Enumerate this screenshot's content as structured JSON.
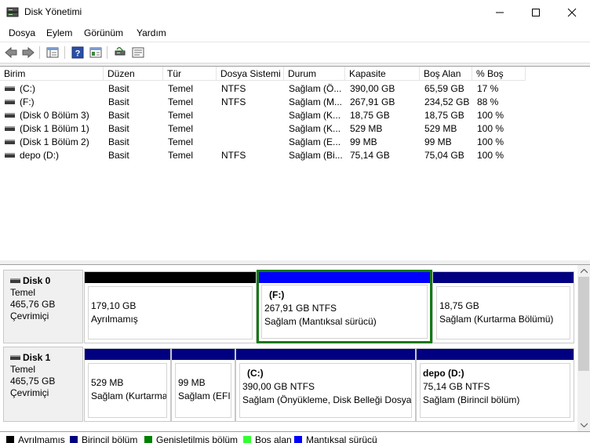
{
  "window": {
    "title": "Disk Yönetimi"
  },
  "menu": [
    "Dosya",
    "Eylem",
    "Görünüm",
    "Yardım"
  ],
  "columns": [
    "Birim",
    "Düzen",
    "Tür",
    "Dosya Sistemi",
    "Durum",
    "Kapasite",
    "Boş Alan",
    "% Boş"
  ],
  "volumes": [
    {
      "name": "(C:)",
      "layout": "Basit",
      "type": "Temel",
      "fs": "NTFS",
      "status": "Sağlam (Ö...",
      "capacity": "390,00 GB",
      "free": "65,59 GB",
      "pct": "17 %"
    },
    {
      "name": "(F:)",
      "layout": "Basit",
      "type": "Temel",
      "fs": "NTFS",
      "status": "Sağlam (M...",
      "capacity": "267,91 GB",
      "free": "234,52 GB",
      "pct": "88 %"
    },
    {
      "name": "(Disk 0 Bölüm 3)",
      "layout": "Basit",
      "type": "Temel",
      "fs": "",
      "status": "Sağlam (K...",
      "capacity": "18,75 GB",
      "free": "18,75 GB",
      "pct": "100 %"
    },
    {
      "name": "(Disk 1 Bölüm 1)",
      "layout": "Basit",
      "type": "Temel",
      "fs": "",
      "status": "Sağlam (K...",
      "capacity": "529 MB",
      "free": "529 MB",
      "pct": "100 %"
    },
    {
      "name": "(Disk 1 Bölüm 2)",
      "layout": "Basit",
      "type": "Temel",
      "fs": "",
      "status": "Sağlam (E...",
      "capacity": "99 MB",
      "free": "99 MB",
      "pct": "100 %"
    },
    {
      "name": "depo (D:)",
      "layout": "Basit",
      "type": "Temel",
      "fs": "NTFS",
      "status": "Sağlam (Bi...",
      "capacity": "75,14 GB",
      "free": "75,04 GB",
      "pct": "100 %"
    }
  ],
  "disks": [
    {
      "name": "Disk 0",
      "type": "Temel",
      "size": "465,76 GB",
      "state": "Çevrimiçi",
      "partitions": [
        {
          "title": "",
          "size": "179,10 GB",
          "status": "Ayrılmamış",
          "kind": "unallocated"
        },
        {
          "title": "(F:)",
          "size": "267,91 GB NTFS",
          "status": "Sağlam (Mantıksal sürücü)",
          "kind": "logical"
        },
        {
          "title": "",
          "size": "18,75 GB",
          "status": "Sağlam (Kurtarma Bölümü)",
          "kind": "primary"
        }
      ]
    },
    {
      "name": "Disk 1",
      "type": "Temel",
      "size": "465,75 GB",
      "state": "Çevrimiçi",
      "partitions": [
        {
          "title": "",
          "size": "529 MB",
          "status": "Sağlam (Kurtarma",
          "kind": "primary"
        },
        {
          "title": "",
          "size": "99 MB",
          "status": "Sağlam (EFI S",
          "kind": "primary"
        },
        {
          "title": "(C:)",
          "size": "390,00 GB NTFS",
          "status": "Sağlam (Önyükleme, Disk Belleği Dosyas",
          "kind": "primary"
        },
        {
          "title": "depo  (D:)",
          "size": "75,14 GB NTFS",
          "status": "Sağlam (Birincil bölüm)",
          "kind": "primary"
        }
      ]
    }
  ],
  "legend": [
    {
      "label": "Ayrılmamış",
      "color": "#000000"
    },
    {
      "label": "Birincil bölüm",
      "color": "#000080"
    },
    {
      "label": "Genişletilmiş bölüm",
      "color": "#008000"
    },
    {
      "label": "Boş alan",
      "color": "#33ff33"
    },
    {
      "label": "Mantıksal sürücü",
      "color": "#0000ff"
    }
  ],
  "colors": {
    "unallocated": "#000000",
    "primary": "#000080",
    "logical": "#0000ff",
    "selection": "#127a12"
  }
}
